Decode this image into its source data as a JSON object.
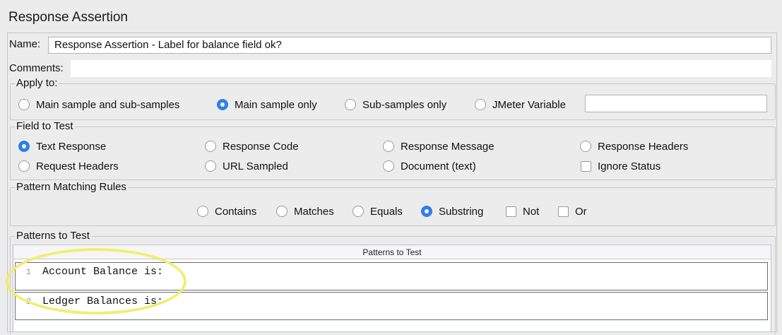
{
  "panel": {
    "title": "Response Assertion"
  },
  "name_field": {
    "label": "Name:",
    "value": "Response Assertion - Label for balance field ok?"
  },
  "comments_field": {
    "label": "Comments:",
    "value": ""
  },
  "apply_to": {
    "legend": "Apply to:",
    "options": [
      {
        "label": "Main sample and sub-samples",
        "checked": false
      },
      {
        "label": "Main sample only",
        "checked": true
      },
      {
        "label": "Sub-samples only",
        "checked": false
      },
      {
        "label": "JMeter Variable",
        "checked": false
      }
    ],
    "variable_value": ""
  },
  "field_to_test": {
    "legend": "Field to Test",
    "options": [
      {
        "label": "Text Response",
        "checked": true,
        "type": "radio"
      },
      {
        "label": "Response Code",
        "checked": false,
        "type": "radio"
      },
      {
        "label": "Response Message",
        "checked": false,
        "type": "radio"
      },
      {
        "label": "Response Headers",
        "checked": false,
        "type": "radio"
      },
      {
        "label": "Request Headers",
        "checked": false,
        "type": "radio"
      },
      {
        "label": "URL Sampled",
        "checked": false,
        "type": "radio"
      },
      {
        "label": "Document (text)",
        "checked": false,
        "type": "radio"
      },
      {
        "label": "Ignore Status",
        "checked": false,
        "type": "checkbox"
      }
    ]
  },
  "pattern_matching": {
    "legend": "Pattern Matching Rules",
    "options": [
      {
        "label": "Contains",
        "checked": false,
        "type": "radio"
      },
      {
        "label": "Matches",
        "checked": false,
        "type": "radio"
      },
      {
        "label": "Equals",
        "checked": false,
        "type": "radio"
      },
      {
        "label": "Substring",
        "checked": true,
        "type": "radio"
      },
      {
        "label": "Not",
        "checked": false,
        "type": "checkbox"
      },
      {
        "label": "Or",
        "checked": false,
        "type": "checkbox"
      }
    ]
  },
  "patterns": {
    "legend": "Patterns to Test",
    "column_header": "Patterns to Test",
    "rows": [
      {
        "num": "1",
        "text": "Account Balance is:"
      },
      {
        "num": "2",
        "text": "Ledger Balances is:"
      }
    ]
  },
  "colors": {
    "accent": "#2f7fea",
    "highlight": "#f1ec6a",
    "background": "#ececec"
  }
}
